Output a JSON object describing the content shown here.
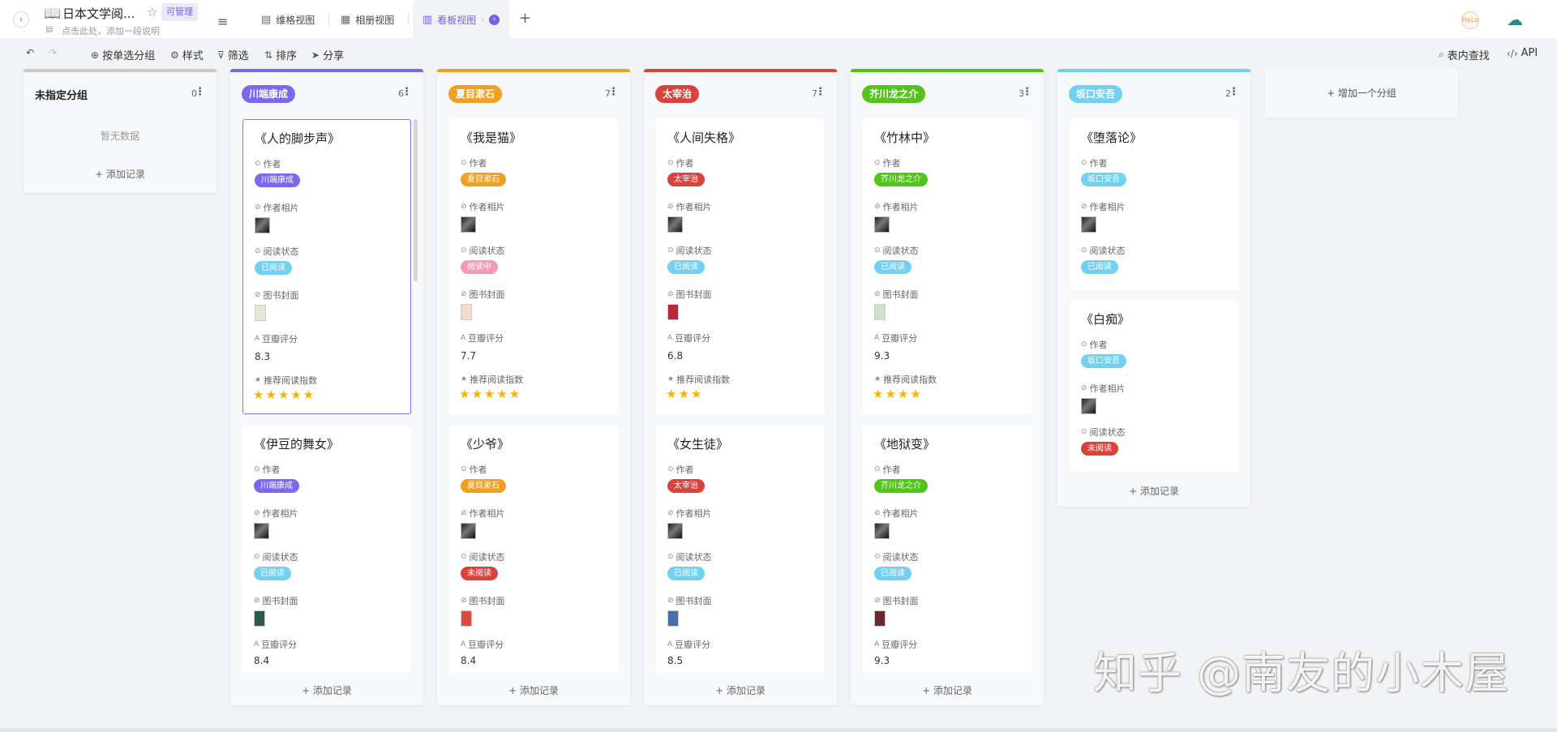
{
  "header": {
    "title": "日本文学阅...",
    "permission": "可管理",
    "description_placeholder": "点击此处，添加一段说明",
    "tabs": [
      {
        "label": "维格视图",
        "icon": "grid-icon"
      },
      {
        "label": "相册视图",
        "icon": "gallery-icon"
      },
      {
        "label": "看板视图",
        "icon": "kanban-icon"
      }
    ]
  },
  "toolbar": {
    "group_by": "按单选分组",
    "style": "样式",
    "filter": "筛选",
    "sort": "排序",
    "share": "分享",
    "find": "表内查找",
    "api": "API"
  },
  "columns": [
    {
      "title": "未指定分组",
      "count": "0",
      "empty": "暂无数据",
      "add": "+ 添加记录"
    },
    {
      "title": "川端康成",
      "count": "6",
      "color": "#7b68ee",
      "add": "+ 添加记录"
    },
    {
      "title": "夏目漱石",
      "count": "7",
      "color": "#f0a020",
      "add": "+ 添加记录"
    },
    {
      "title": "太宰治",
      "count": "7",
      "color": "#d9433e",
      "add": "+ 添加记录"
    },
    {
      "title": "芥川龙之介",
      "count": "3",
      "color": "#52c41a",
      "add": "+ 添加记录"
    },
    {
      "title": "坂口安吾",
      "count": "2",
      "color": "#72d0f0",
      "add": "+ 添加记录"
    }
  ],
  "fields": {
    "author": "作者",
    "photo": "作者相片",
    "status": "阅读状态",
    "cover": "图书封面",
    "rating": "豆瓣评分",
    "recommend": "推荐阅读指数"
  },
  "status_colors": {
    "已阅读": "#72d0f0",
    "阅读中": "#f39bb5",
    "未阅读": "#d9433e"
  },
  "cards": {
    "c1a": {
      "title": "《人的脚步声》",
      "author": "川端康成",
      "status": "已阅读",
      "rating": "8.3",
      "stars": "★★★★★"
    },
    "c1b": {
      "title": "《伊豆的舞女》",
      "author": "川端康成",
      "status": "已阅读",
      "rating": "8.4"
    },
    "c2a": {
      "title": "《我是猫》",
      "author": "夏目漱石",
      "status": "阅读中",
      "rating": "7.7",
      "stars": "★★★★★"
    },
    "c2b": {
      "title": "《少爷》",
      "author": "夏目漱石",
      "status": "未阅读",
      "rating": "8.4"
    },
    "c3a": {
      "title": "《人间失格》",
      "author": "太宰治",
      "status": "已阅读",
      "rating": "6.8",
      "stars": "★★★"
    },
    "c3b": {
      "title": "《女生徒》",
      "author": "太宰治",
      "status": "已阅读",
      "rating": "8.5"
    },
    "c4a": {
      "title": "《竹林中》",
      "author": "芥川龙之介",
      "status": "已阅读",
      "rating": "9.3",
      "stars": "★★★★"
    },
    "c4b": {
      "title": "《地狱变》",
      "author": "芥川龙之介",
      "status": "已阅读",
      "rating": "9.3"
    },
    "c5a": {
      "title": "《堕落论》",
      "author": "坂口安吾",
      "status": "已阅读"
    },
    "c5b": {
      "title": "《白痴》",
      "author": "坂口安吾",
      "status": "未阅读"
    }
  },
  "add_group": "+ 增加一个分组",
  "watermark": "知乎 @南友的小木屋",
  "avatar_text": "HeLo"
}
